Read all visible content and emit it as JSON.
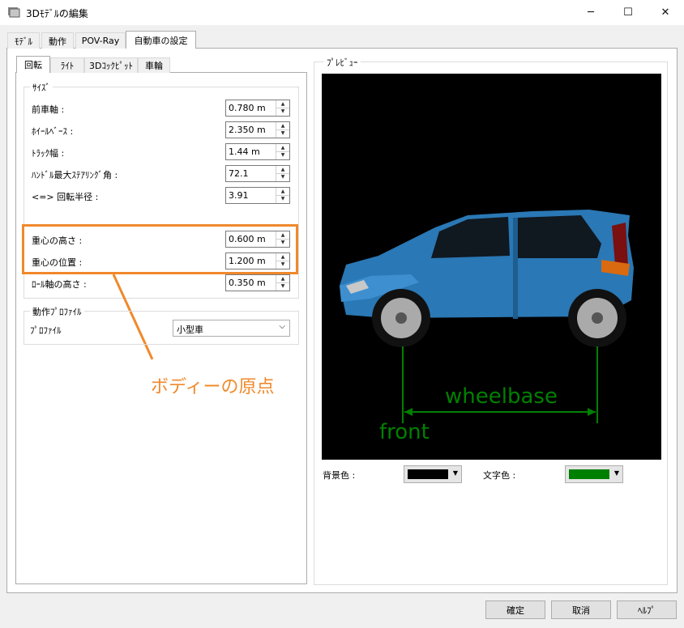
{
  "window": {
    "title": "3Dﾓﾃﾞﾙの編集",
    "min_label": "─",
    "max_label": "☐",
    "close_label": "✕"
  },
  "tabs": [
    {
      "label": "ﾓﾃﾞﾙ"
    },
    {
      "label": "動作"
    },
    {
      "label": "POV-Ray"
    },
    {
      "label": "自動車の設定"
    }
  ],
  "subtabs": [
    {
      "label": "回転"
    },
    {
      "label": "ﾗｲﾄ"
    },
    {
      "label": "3Dｺｯｸﾋﾟｯﾄ"
    },
    {
      "label": "車輪"
    }
  ],
  "size_group": {
    "title": "ｻｲｽﾞ",
    "fields": [
      {
        "label": "前車軸 :",
        "value": "0.780 m"
      },
      {
        "label": "ﾎｲｰﾙﾍﾞｰｽ :",
        "value": "2.350 m"
      },
      {
        "label": "ﾄﾗｯｸ幅 :",
        "value": "1.44 m"
      },
      {
        "label": "ﾊﾝﾄﾞﾙ最大ｽﾃｱﾘﾝｸﾞ角 :",
        "value": "72.1"
      },
      {
        "label": "<=> 回転半径 :",
        "value": "3.91"
      },
      {
        "label": "重心の高さ :",
        "value": "0.600 m"
      },
      {
        "label": "重心の位置 :",
        "value": "1.200 m"
      },
      {
        "label": "ﾛｰﾙ軸の高さ :",
        "value": "0.350 m"
      }
    ]
  },
  "profile_group": {
    "title": "動作ﾌﾟﾛﾌｧｲﾙ",
    "label": "ﾌﾟﾛﾌｧｲﾙ",
    "selected": "小型車"
  },
  "preview": {
    "title": "ﾌﾟﾚﾋﾞｭｰ",
    "front_label": "front",
    "wheelbase_label": "wheelbase",
    "bg_label": "背景色 :",
    "text_label": "文字色 :",
    "bg_color": "#000000",
    "text_color": "#008000"
  },
  "annotation": {
    "label": "ボディーの原点",
    "color": "#f0892b"
  },
  "buttons": {
    "ok": "確定",
    "cancel": "取消",
    "help": "ﾍﾙﾌﾟ"
  }
}
